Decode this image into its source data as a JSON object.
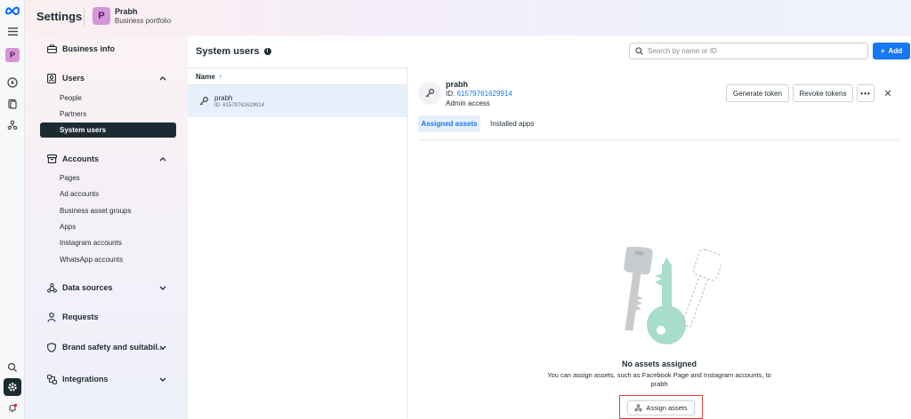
{
  "header": {
    "title": "Settings",
    "portfolio_initial": "P",
    "portfolio_name": "Prabh",
    "portfolio_sub": "Business portfolio"
  },
  "rail": {
    "avatar_initial": "P"
  },
  "nav": {
    "business_info": "Business info",
    "users": "Users",
    "users_items": [
      "People",
      "Partners",
      "System users"
    ],
    "accounts": "Accounts",
    "accounts_items": [
      "Pages",
      "Ad accounts",
      "Business asset groups",
      "Apps",
      "Instagram accounts",
      "WhatsApp accounts"
    ],
    "data_sources": "Data sources",
    "requests": "Requests",
    "brand_safety": "Brand safety and suitabil...",
    "integrations": "Integrations"
  },
  "main": {
    "title": "System users",
    "search_placeholder": "Search by name or ID",
    "add_label": "Add",
    "list_header": "Name",
    "row": {
      "name": "prabh",
      "id": "ID: 61579761629914"
    }
  },
  "detail": {
    "name": "prabh",
    "id_label": "ID:",
    "id_value": "61579761629914",
    "access": "Admin access",
    "generate_token": "Generate token",
    "revoke_tokens": "Revoke tokens",
    "more": "•••",
    "close": "✕",
    "tabs": [
      "Assigned assets",
      "Installed apps"
    ],
    "empty_title": "No assets assigned",
    "empty_desc": "You can assign assets, such as Facebook Page and Instagram accounts, to prabh",
    "assign_label": "Assign assets"
  },
  "colors": {
    "accent": "#1877f2",
    "active_nav": "#1c2b33",
    "avatar": "#d695d7",
    "highlight": "#e0413b"
  }
}
